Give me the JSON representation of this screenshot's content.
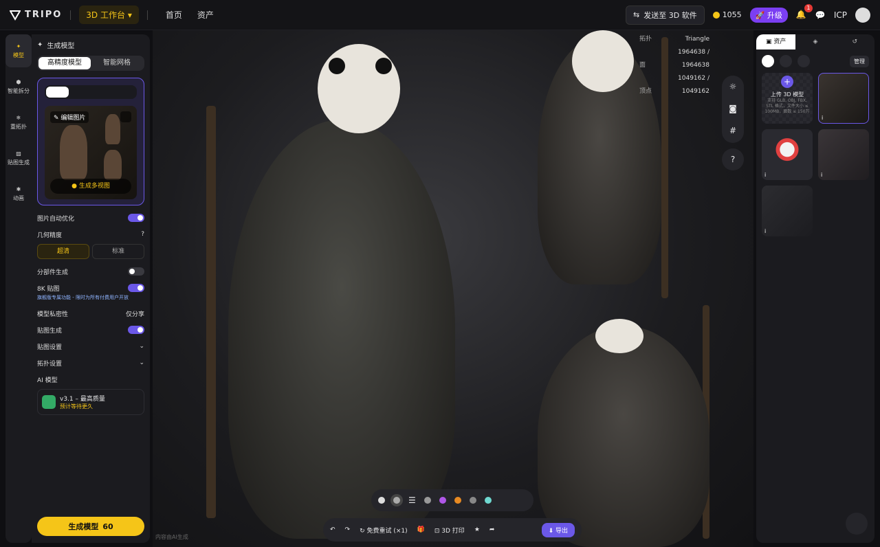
{
  "topbar": {
    "brand": "TRIPO",
    "workspace": "3D 工作台",
    "nav": [
      "首页",
      "资产"
    ],
    "send": "发送至 3D 软件",
    "credits": "1055",
    "upgrade": "升级",
    "notif_count": "1",
    "user": "ICP"
  },
  "rail": [
    {
      "label": "模型"
    },
    {
      "label": "智能拆分"
    },
    {
      "label": "重拓扑"
    },
    {
      "label": "贴图生成"
    },
    {
      "label": "动画"
    }
  ],
  "panel": {
    "title": "生成模型",
    "mode_hd": "高精度模型",
    "mode_smart": "智能网格",
    "edit_image": "编辑图片",
    "gen_multi": "生成多视图",
    "auto_opt": "图片自动优化",
    "geo": "几何精度",
    "geo_high": "超清",
    "geo_std": "标准",
    "parts": "分部件生成",
    "tex8k": "8K 贴图",
    "tex8k_note": "旗舰版专属功能 - 限时为所有付费用户开放",
    "privacy": "模型私密性",
    "privacy_val": "仅分享",
    "texgen": "贴图生成",
    "tex_set": "贴图设置",
    "topo_set": "拓扑设置",
    "ai_model": "AI 模型",
    "ai_name": "v3.1 – 最高质量",
    "ai_sub": "预计等待更久",
    "gen_btn": "生成模型",
    "gen_cost": "60"
  },
  "stats": {
    "topo_label": "拓扑",
    "topo_val": "Triangle",
    "face_label": "面",
    "face_val": "1964638 / 1964638",
    "vert_label": "顶点",
    "vert_val": "1049162 / 1049162"
  },
  "actions": {
    "retry": "免费重试 (×1)",
    "print": "3D 打印",
    "export": "导出"
  },
  "footer_note": "内容由AI生成",
  "assets": {
    "tab_assets": "资产",
    "manage": "管理",
    "upload_title": "上传 3D 模型",
    "upload_sub": "支持 GLB, OBJ, FBX, STL 格式，文件大小 ≤ 100MB，面数 ≤ 150万"
  }
}
